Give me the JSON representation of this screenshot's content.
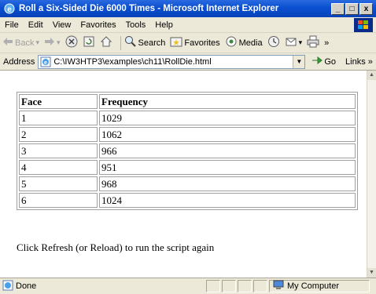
{
  "window": {
    "title": "Roll a Six-Sided Die 6000 Times - Microsoft Internet Explorer",
    "minimize_label": "_",
    "maximize_label": "□",
    "close_label": "x"
  },
  "menu": [
    "File",
    "Edit",
    "View",
    "Favorites",
    "Tools",
    "Help"
  ],
  "toolbar": {
    "back_label": "Back",
    "search_label": "Search",
    "favorites_label": "Favorites",
    "media_label": "Media"
  },
  "address": {
    "label": "Address",
    "url": "C:\\IW3HTP3\\examples\\ch11\\RollDie.html",
    "go_label": "Go",
    "links_label": "Links"
  },
  "table": {
    "headers": [
      "Face",
      "Frequency"
    ],
    "rows": [
      [
        "1",
        "1029"
      ],
      [
        "2",
        "1062"
      ],
      [
        "3",
        "966"
      ],
      [
        "4",
        "951"
      ],
      [
        "5",
        "968"
      ],
      [
        "6",
        "1024"
      ]
    ]
  },
  "page": {
    "hint": "Click Refresh (or Reload) to run the script again"
  },
  "status": {
    "text": "Done",
    "zone": "My Computer"
  },
  "colors": {
    "titlebar": "#0a4fd0",
    "chrome": "#ece9d8"
  }
}
